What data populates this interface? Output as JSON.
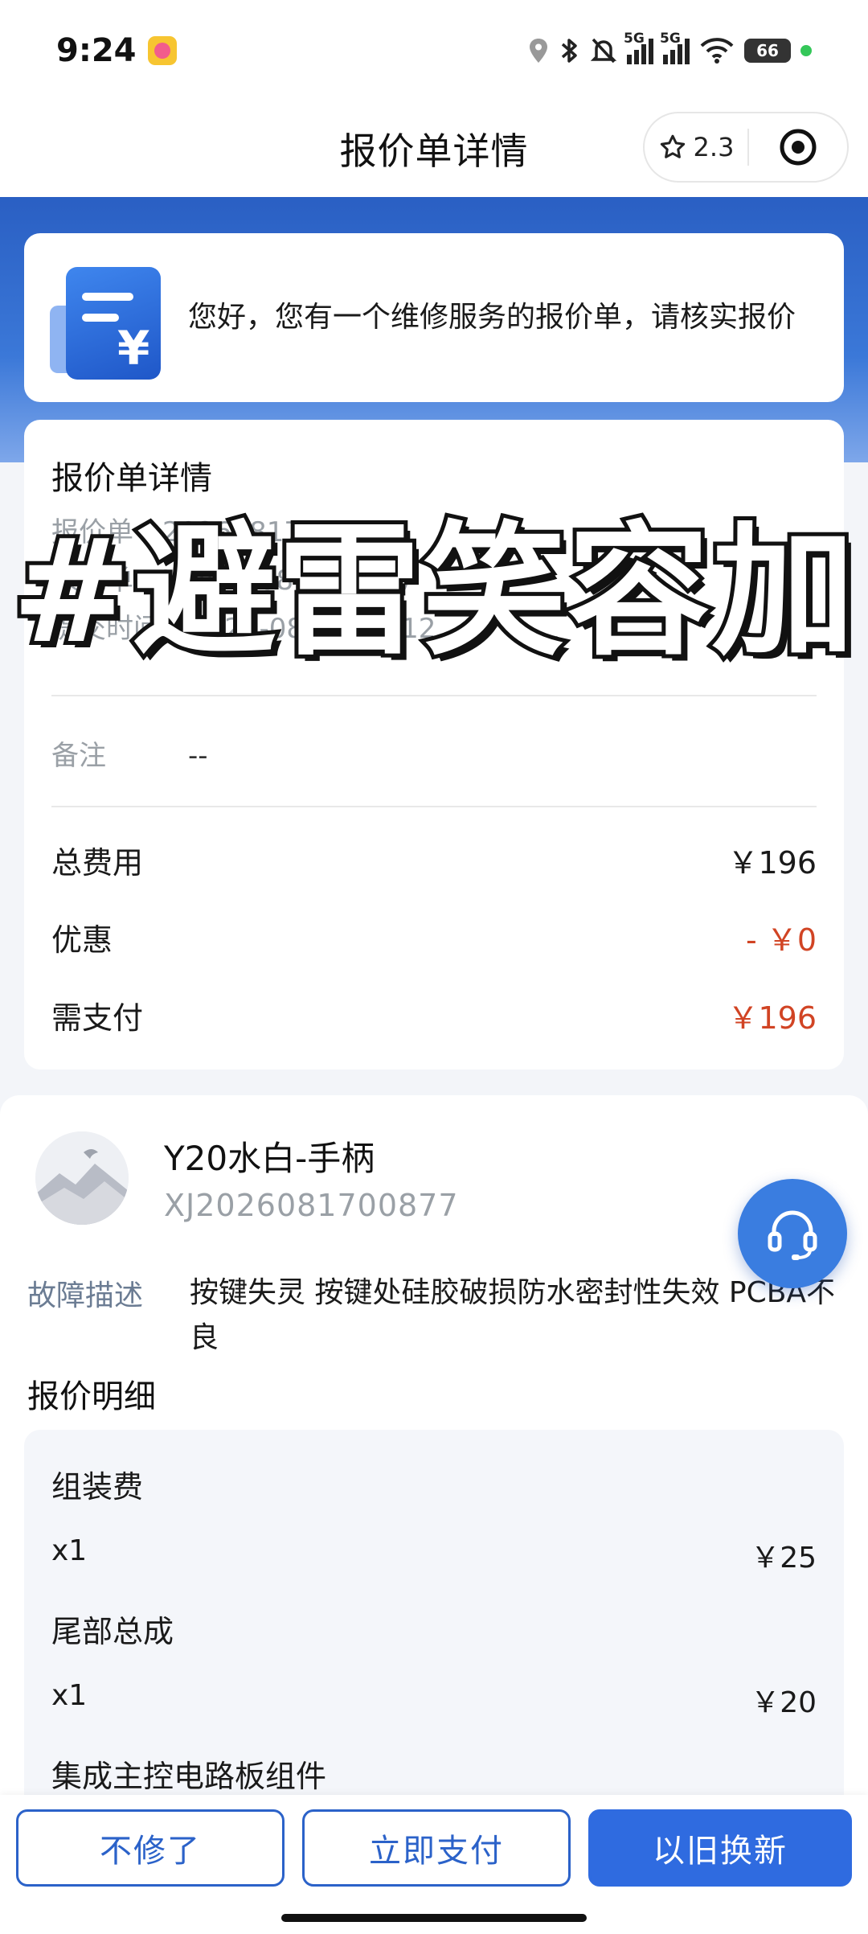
{
  "status_bar": {
    "time": "9:24",
    "battery": "66",
    "net1": "5G",
    "net2": "5G"
  },
  "header": {
    "title": "报价单详情",
    "rating": "2.3"
  },
  "notice": {
    "text": "您好，您有一个维修服务的报价单，请核实报价"
  },
  "detail": {
    "title": "报价单详情",
    "meta": [
      {
        "label": "报价单",
        "value": "2026081700877"
      },
      {
        "label": "来源单",
        "value": "XJ2026081700877"
      },
      {
        "label": "提交时间",
        "value": "2026-08-17 09:12"
      }
    ],
    "remark_label": "备注",
    "remark_value": "--",
    "total_label": "总费用",
    "total_value": "￥196",
    "discount_label": "优惠",
    "discount_value": "- ￥0",
    "pay_label": "需支付",
    "pay_value": "￥196"
  },
  "watermark": "#避雷笑容加",
  "product": {
    "name": "Y20水白-手柄",
    "code": "XJ2026081700877",
    "fault_label": "故障描述",
    "fault_text": "按键失灵 按键处硅胶破损防水密封性失效 PCBA不良",
    "section_title": "报价明细",
    "items": [
      {
        "name": "组装费",
        "qty": "x1",
        "price": "￥25"
      },
      {
        "name": "尾部总成",
        "qty": "x1",
        "price": "￥20"
      },
      {
        "name": "集成主控电路板组件",
        "qty": "",
        "price": ""
      }
    ]
  },
  "actions": {
    "cancel": "不修了",
    "pay": "立即支付",
    "trade_in": "以旧换新"
  },
  "colors": {
    "primary": "#2f6be0",
    "red": "#d14424",
    "muted": "#9aa0a6"
  },
  "icons": [
    "location-icon",
    "bluetooth-icon",
    "mute-bell-icon",
    "signal-icon",
    "wifi-icon",
    "battery-icon",
    "star-icon",
    "target-icon",
    "quote-document-icon",
    "headset-icon"
  ]
}
